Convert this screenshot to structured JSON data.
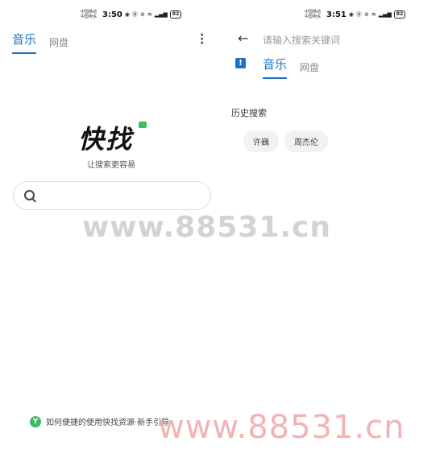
{
  "left": {
    "status": {
      "carrier_top": "中国移动",
      "carrier_bottom": "中国电信",
      "time": "3:50",
      "battery": "82"
    },
    "tabs": [
      {
        "label": "音乐"
      },
      {
        "label": "网盘"
      }
    ],
    "more_icon": "more-vertical-icon",
    "logo_text": "快找",
    "slogan": "让搜索更容易",
    "search_icon": "search-icon",
    "tip": {
      "icon_text": "Y",
      "text": "如何便捷的使用快找资源·新手引导"
    }
  },
  "right": {
    "status": {
      "carrier_top": "中国移动",
      "carrier_bottom": "中国电信",
      "time": "3:51",
      "battery": "82"
    },
    "back_icon": "arrow-left-icon",
    "search_placeholder": "请输入搜索关键词",
    "notice_icon": "!",
    "tabs": [
      {
        "label": "音乐"
      },
      {
        "label": "网盘"
      }
    ],
    "history_title": "历史搜索",
    "history": [
      "许巍",
      "周杰伦"
    ]
  },
  "watermarks": [
    "www.88531.cn",
    "www.88531.cn"
  ],
  "colors": {
    "accent": "#1a73c8",
    "brand_green": "#3dbb63"
  }
}
